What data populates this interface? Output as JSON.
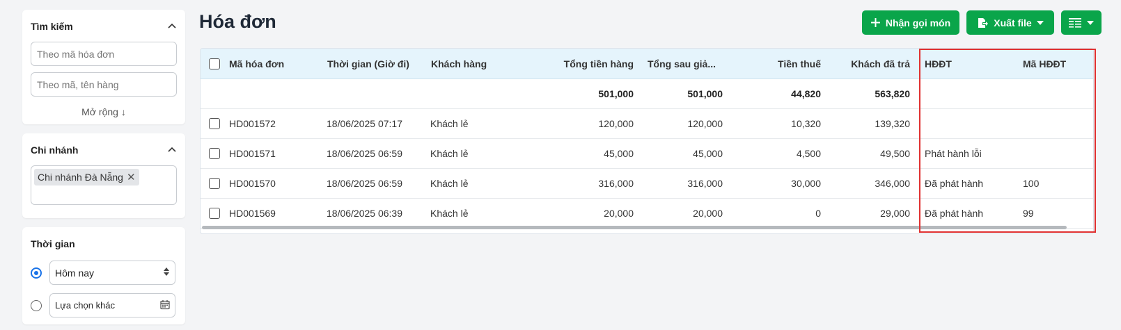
{
  "sidebar": {
    "search": {
      "title": "Tìm kiếm",
      "invoice_placeholder": "Theo mã hóa đơn",
      "product_placeholder": "Theo mã, tên hàng",
      "expand_label": "Mở rộng ↓"
    },
    "branch": {
      "title": "Chi nhánh",
      "selected_tag": "Chi nhánh Đà Nẵng"
    },
    "time": {
      "title": "Thời gian",
      "option_today": "Hôm nay",
      "option_other": "Lựa chọn khác"
    }
  },
  "header": {
    "title": "Hóa đơn",
    "order_button": "Nhận gọi món",
    "export_button": "Xuất file",
    "brand_color": "#0aa54a"
  },
  "table": {
    "columns": [
      "Mã hóa đơn",
      "Thời gian (Giờ đi)",
      "Khách hàng",
      "Tổng tiền hàng",
      "Tổng sau giả...",
      "Tiền thuế",
      "Khách đã trả",
      "HĐĐT",
      "Mã HĐĐT"
    ],
    "totals": {
      "total": "501,000",
      "after_discount": "501,000",
      "tax": "44,820",
      "paid": "563,820"
    },
    "rows": [
      {
        "code": "HD001572",
        "time": "18/06/2025 07:17",
        "customer": "Khách lẻ",
        "total": "120,000",
        "after_discount": "120,000",
        "tax": "10,320",
        "paid": "139,320",
        "einvoice": "",
        "einvoice_code": ""
      },
      {
        "code": "HD001571",
        "time": "18/06/2025 06:59",
        "customer": "Khách lẻ",
        "total": "45,000",
        "after_discount": "45,000",
        "tax": "4,500",
        "paid": "49,500",
        "einvoice": "Phát hành lỗi",
        "einvoice_code": ""
      },
      {
        "code": "HD001570",
        "time": "18/06/2025 06:59",
        "customer": "Khách lẻ",
        "total": "316,000",
        "after_discount": "316,000",
        "tax": "30,000",
        "paid": "346,000",
        "einvoice": "Đã phát hành",
        "einvoice_code": "100"
      },
      {
        "code": "HD001569",
        "time": "18/06/2025 06:39",
        "customer": "Khách lẻ",
        "total": "20,000",
        "after_discount": "20,000",
        "tax": "0",
        "paid": "29,000",
        "einvoice": "Đã phát hành",
        "einvoice_code": "99"
      }
    ],
    "header_bg": "#e5f4fc",
    "highlight_color": "#e03131"
  }
}
